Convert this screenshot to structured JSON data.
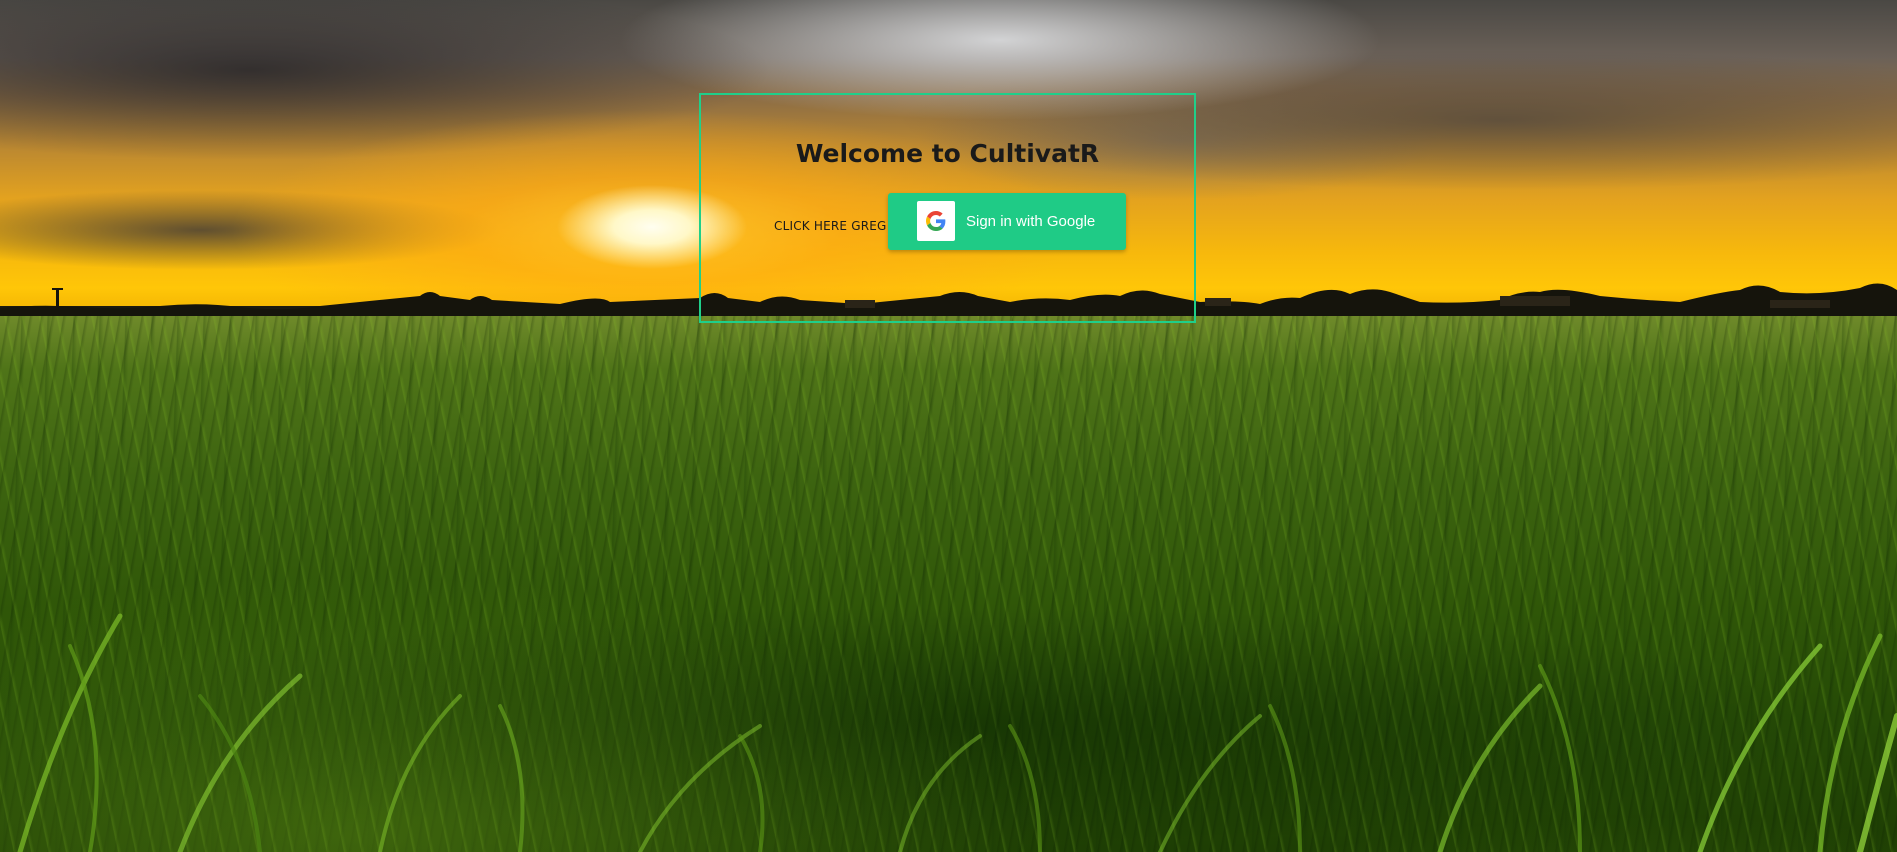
{
  "page": {
    "title": "Welcome to CultivatR"
  },
  "login": {
    "prompt_text": "CLICK HERE GREG",
    "google_button_label": "Sign in with Google"
  },
  "icons": {
    "google": "google-g-icon"
  },
  "colors": {
    "accent": "#1fcb86",
    "box_border": "#1fcf8a",
    "title_text": "#1a1a1a",
    "button_text": "#ffffff"
  }
}
